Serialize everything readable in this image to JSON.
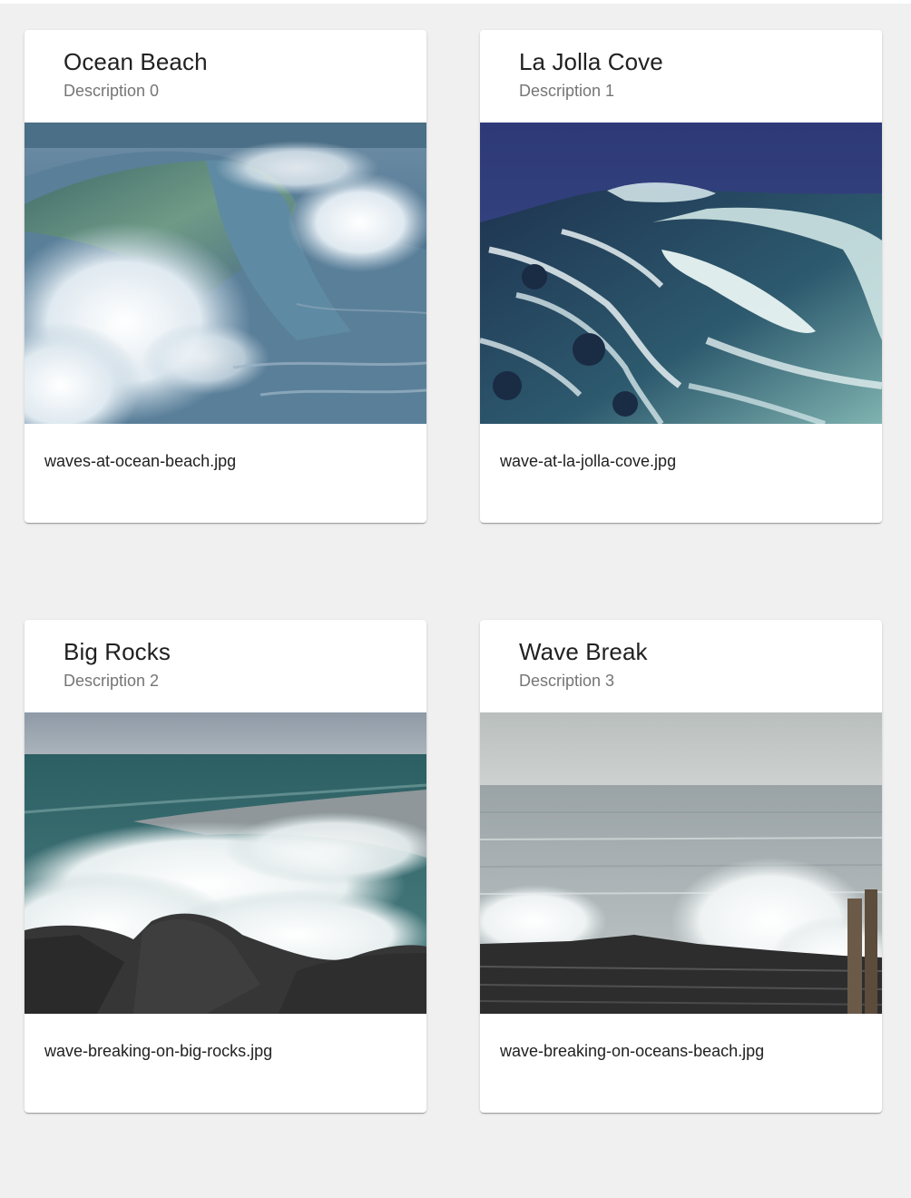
{
  "cards": [
    {
      "title": "Ocean Beach",
      "subtitle": "Description 0",
      "filename": "waves-at-ocean-beach.jpg",
      "image": "photo of a large curling blue-green ocean wave with white spray"
    },
    {
      "title": "La Jolla Cove",
      "subtitle": "Description 1",
      "filename": "wave-at-la-jolla-cove.jpg",
      "image": "photo of a deep blue sea with a foamy white-veined wave"
    },
    {
      "title": "Big Rocks",
      "subtitle": "Description 2",
      "filename": "wave-breaking-on-big-rocks.jpg",
      "image": "photo of white surf breaking over dark boulders under a grey sky"
    },
    {
      "title": "Wave Break",
      "subtitle": "Description 3",
      "filename": "wave-breaking-on-oceans-beach.jpg",
      "image": "photo of silvery choppy sea with spray hitting a dark rocky ledge and wooden posts"
    }
  ],
  "colors": {
    "page_background": "#f0f0f0",
    "card_background": "#ffffff",
    "title_text": "#212121",
    "subtitle_text": "#757575"
  }
}
